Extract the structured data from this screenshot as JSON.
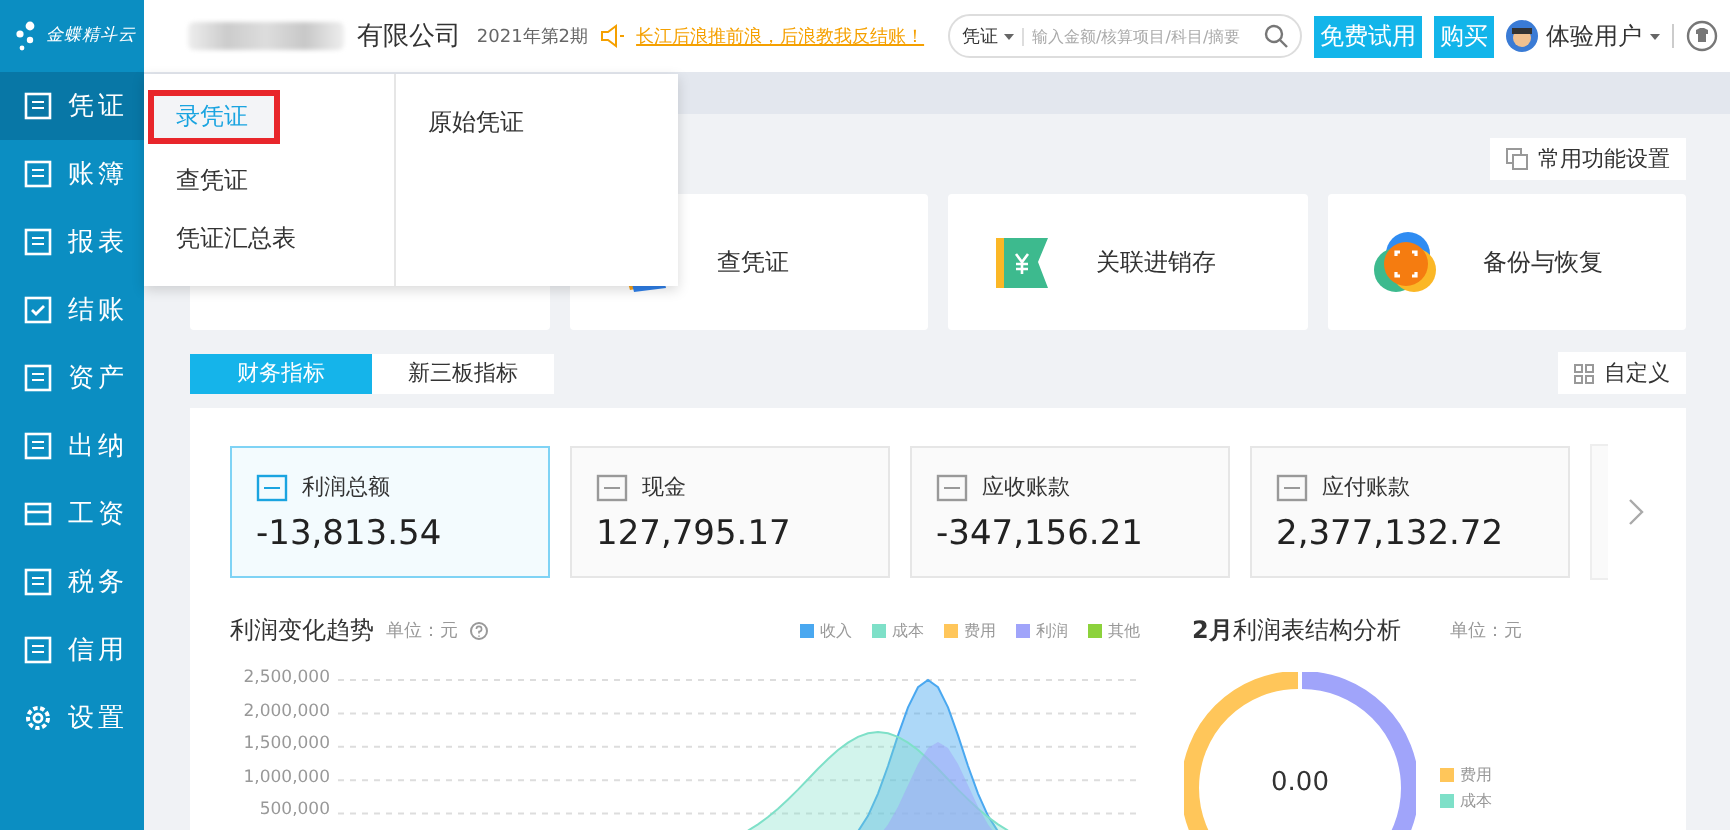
{
  "brand": {
    "name": "金蝶精斗云"
  },
  "sidebar": {
    "items": [
      {
        "label": "凭证",
        "kind": "page",
        "selected": true
      },
      {
        "label": "账簿",
        "kind": "page",
        "selected": false
      },
      {
        "label": "报表",
        "kind": "page",
        "selected": false
      },
      {
        "label": "结账",
        "kind": "check",
        "selected": false
      },
      {
        "label": "资产",
        "kind": "page",
        "selected": false
      },
      {
        "label": "出纳",
        "kind": "page",
        "selected": false
      },
      {
        "label": "工资",
        "kind": "card",
        "selected": false
      },
      {
        "label": "税务",
        "kind": "page",
        "selected": false
      },
      {
        "label": "信用",
        "kind": "page",
        "selected": false
      },
      {
        "label": "设置",
        "kind": "settings",
        "selected": false
      }
    ]
  },
  "header": {
    "company": "有限公司",
    "period": "2021年第2期",
    "notice": "长江后浪推前浪，后浪教我反结账！",
    "search": {
      "scope": "凭证",
      "placeholder": "输入金额/核算项目/科目/摘要"
    },
    "buttons": [
      "免费试用",
      "购买"
    ],
    "user": "体验用户"
  },
  "menu": {
    "items": [
      {
        "label": "录凭证",
        "selected": true
      },
      {
        "label": "查凭证",
        "selected": false
      },
      {
        "label": "凭证汇总表",
        "selected": false
      }
    ],
    "side_items": [
      "原始凭证"
    ]
  },
  "common_settings": "常用功能设置",
  "quick_cards": [
    {
      "label": "查凭证",
      "kind": "voucher"
    },
    {
      "label": "关联进销存",
      "kind": "inventory"
    },
    {
      "label": "备份与恢复",
      "kind": "backup"
    }
  ],
  "tabs": [
    {
      "label": "财务指标",
      "selected": true
    },
    {
      "label": "新三板指标",
      "selected": false
    }
  ],
  "customize": "自定义",
  "metrics": [
    {
      "label": "利润总额",
      "value": "-13,813.54",
      "selected": true
    },
    {
      "label": "现金",
      "value": "127,795.17",
      "selected": false
    },
    {
      "label": "应收账款",
      "value": "-347,156.21",
      "selected": false
    },
    {
      "label": "应付账款",
      "value": "2,377,132.72",
      "selected": false
    }
  ],
  "trend": {
    "title": "利润变化趋势",
    "unit": "单位：元",
    "legend": [
      {
        "label": "收入",
        "color": "#4aa8f0"
      },
      {
        "label": "成本",
        "color": "#7ee0c8"
      },
      {
        "label": "费用",
        "color": "#ffc65a"
      },
      {
        "label": "利润",
        "color": "#a0a4fa"
      },
      {
        "label": "其他",
        "color": "#8cd23c"
      }
    ],
    "y_labels": [
      "2,500,000",
      "2,000,000",
      "1,500,000",
      "1,000,000",
      "500,000"
    ]
  },
  "structure": {
    "title": "**2月**利润表结构分析",
    "unit": "单位：元",
    "center": "0.00",
    "legend": [
      {
        "label": "费用",
        "color": "#ffc65a"
      },
      {
        "label": "成本",
        "color": "#7ee0c8"
      }
    ]
  }
}
